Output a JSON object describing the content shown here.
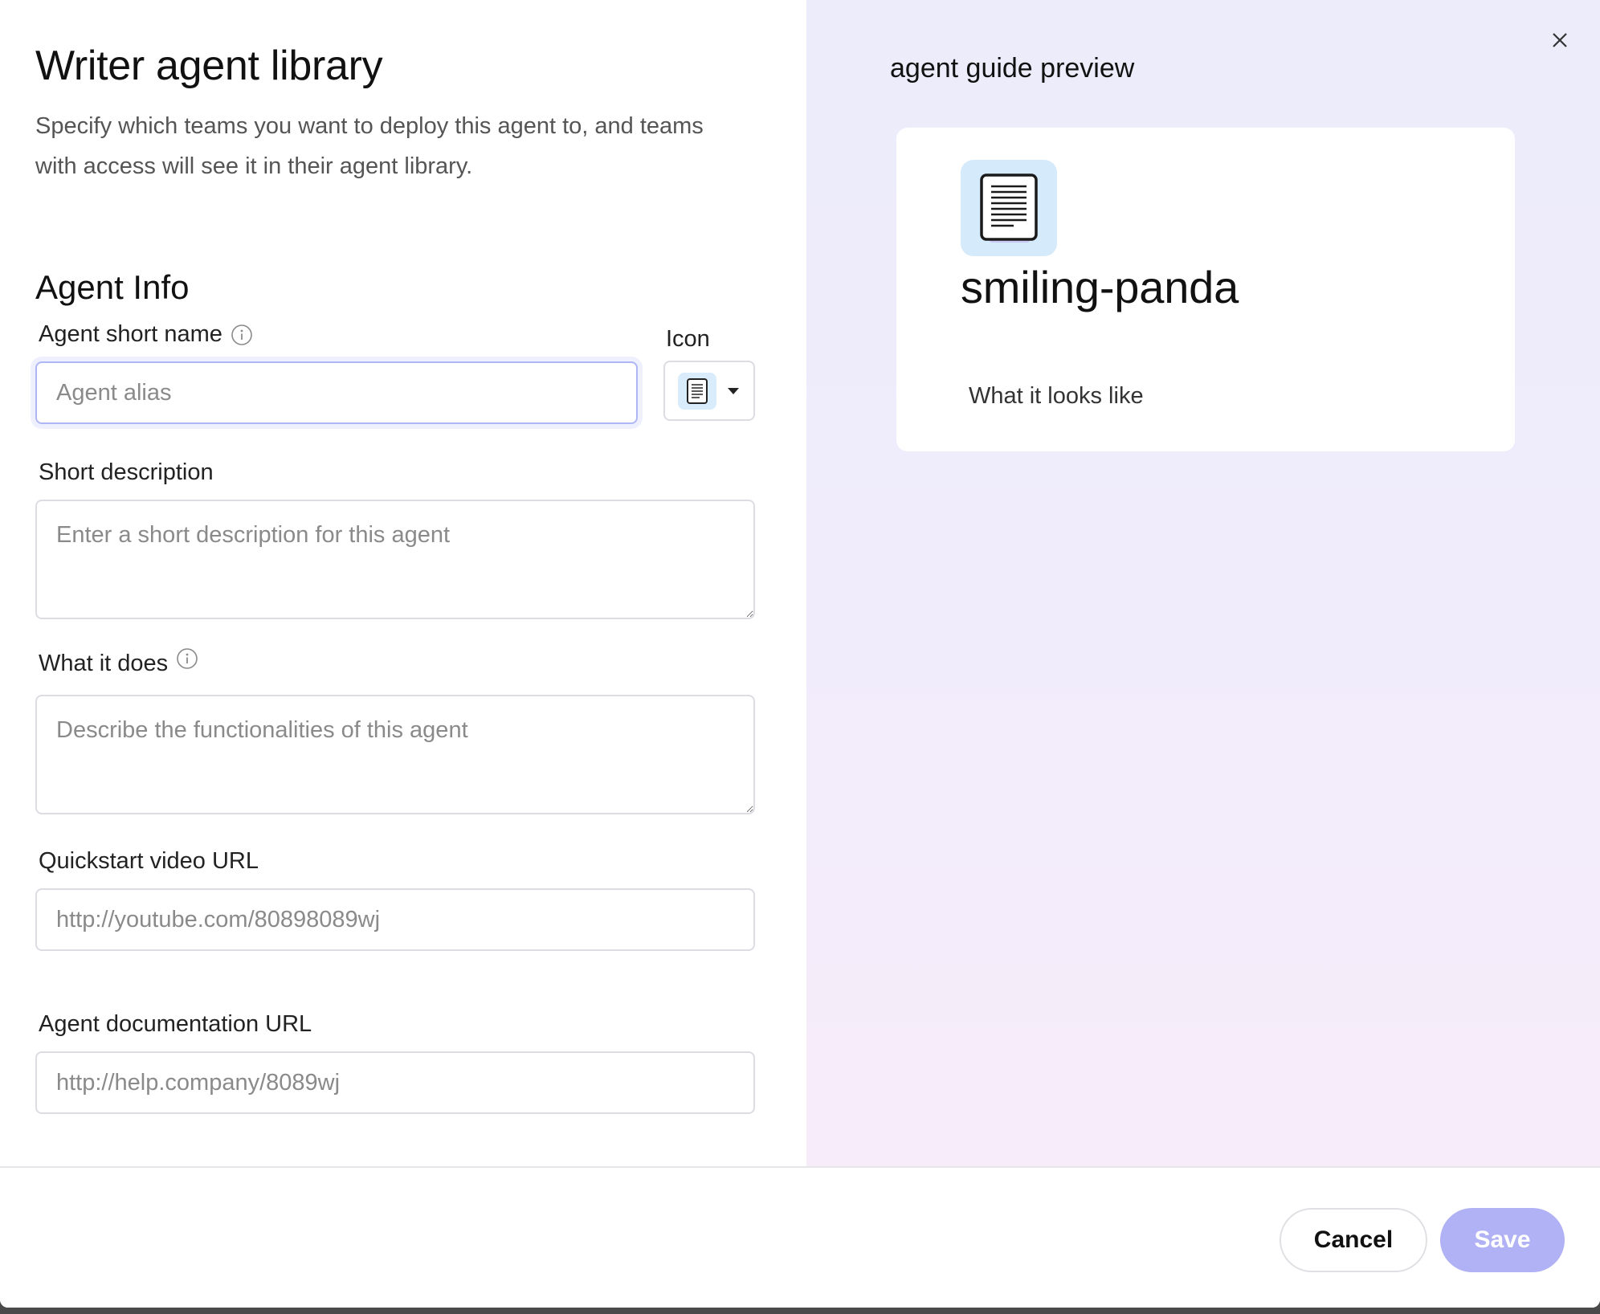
{
  "dialog": {
    "title": "Writer agent library",
    "subtitle": "Specify which teams you want to deploy this agent to, and teams with access will see it in their agent library."
  },
  "agent_info": {
    "section_title": "Agent Info",
    "short_name": {
      "label": "Agent short name",
      "placeholder": "Agent alias",
      "value": ""
    },
    "icon": {
      "label": "Icon",
      "selected": "document-icon"
    },
    "short_description": {
      "label": "Short description",
      "placeholder": "Enter a short description for this agent",
      "value": ""
    },
    "what_it_does": {
      "label": "What it does",
      "placeholder": "Describe the functionalities of this agent",
      "value": ""
    },
    "quickstart_video": {
      "label": "Quickstart video URL",
      "placeholder": "http://youtube.com/80898089wj",
      "value": ""
    },
    "documentation": {
      "label": "Agent documentation URL",
      "placeholder": "http://help.company/8089wj",
      "value": ""
    }
  },
  "preview": {
    "title": "agent guide preview",
    "agent_name": "smiling-panda",
    "section_label": "What it looks like",
    "icon": "document-icon"
  },
  "footer": {
    "cancel_label": "Cancel",
    "save_label": "Save"
  },
  "colors": {
    "accent": "#b1b1f5",
    "focus_border": "#aeb6f5",
    "icon_chip_bg": "#d5eafb",
    "preview_bg_top": "#ececfb",
    "preview_bg_bottom": "#f7ecfa"
  }
}
